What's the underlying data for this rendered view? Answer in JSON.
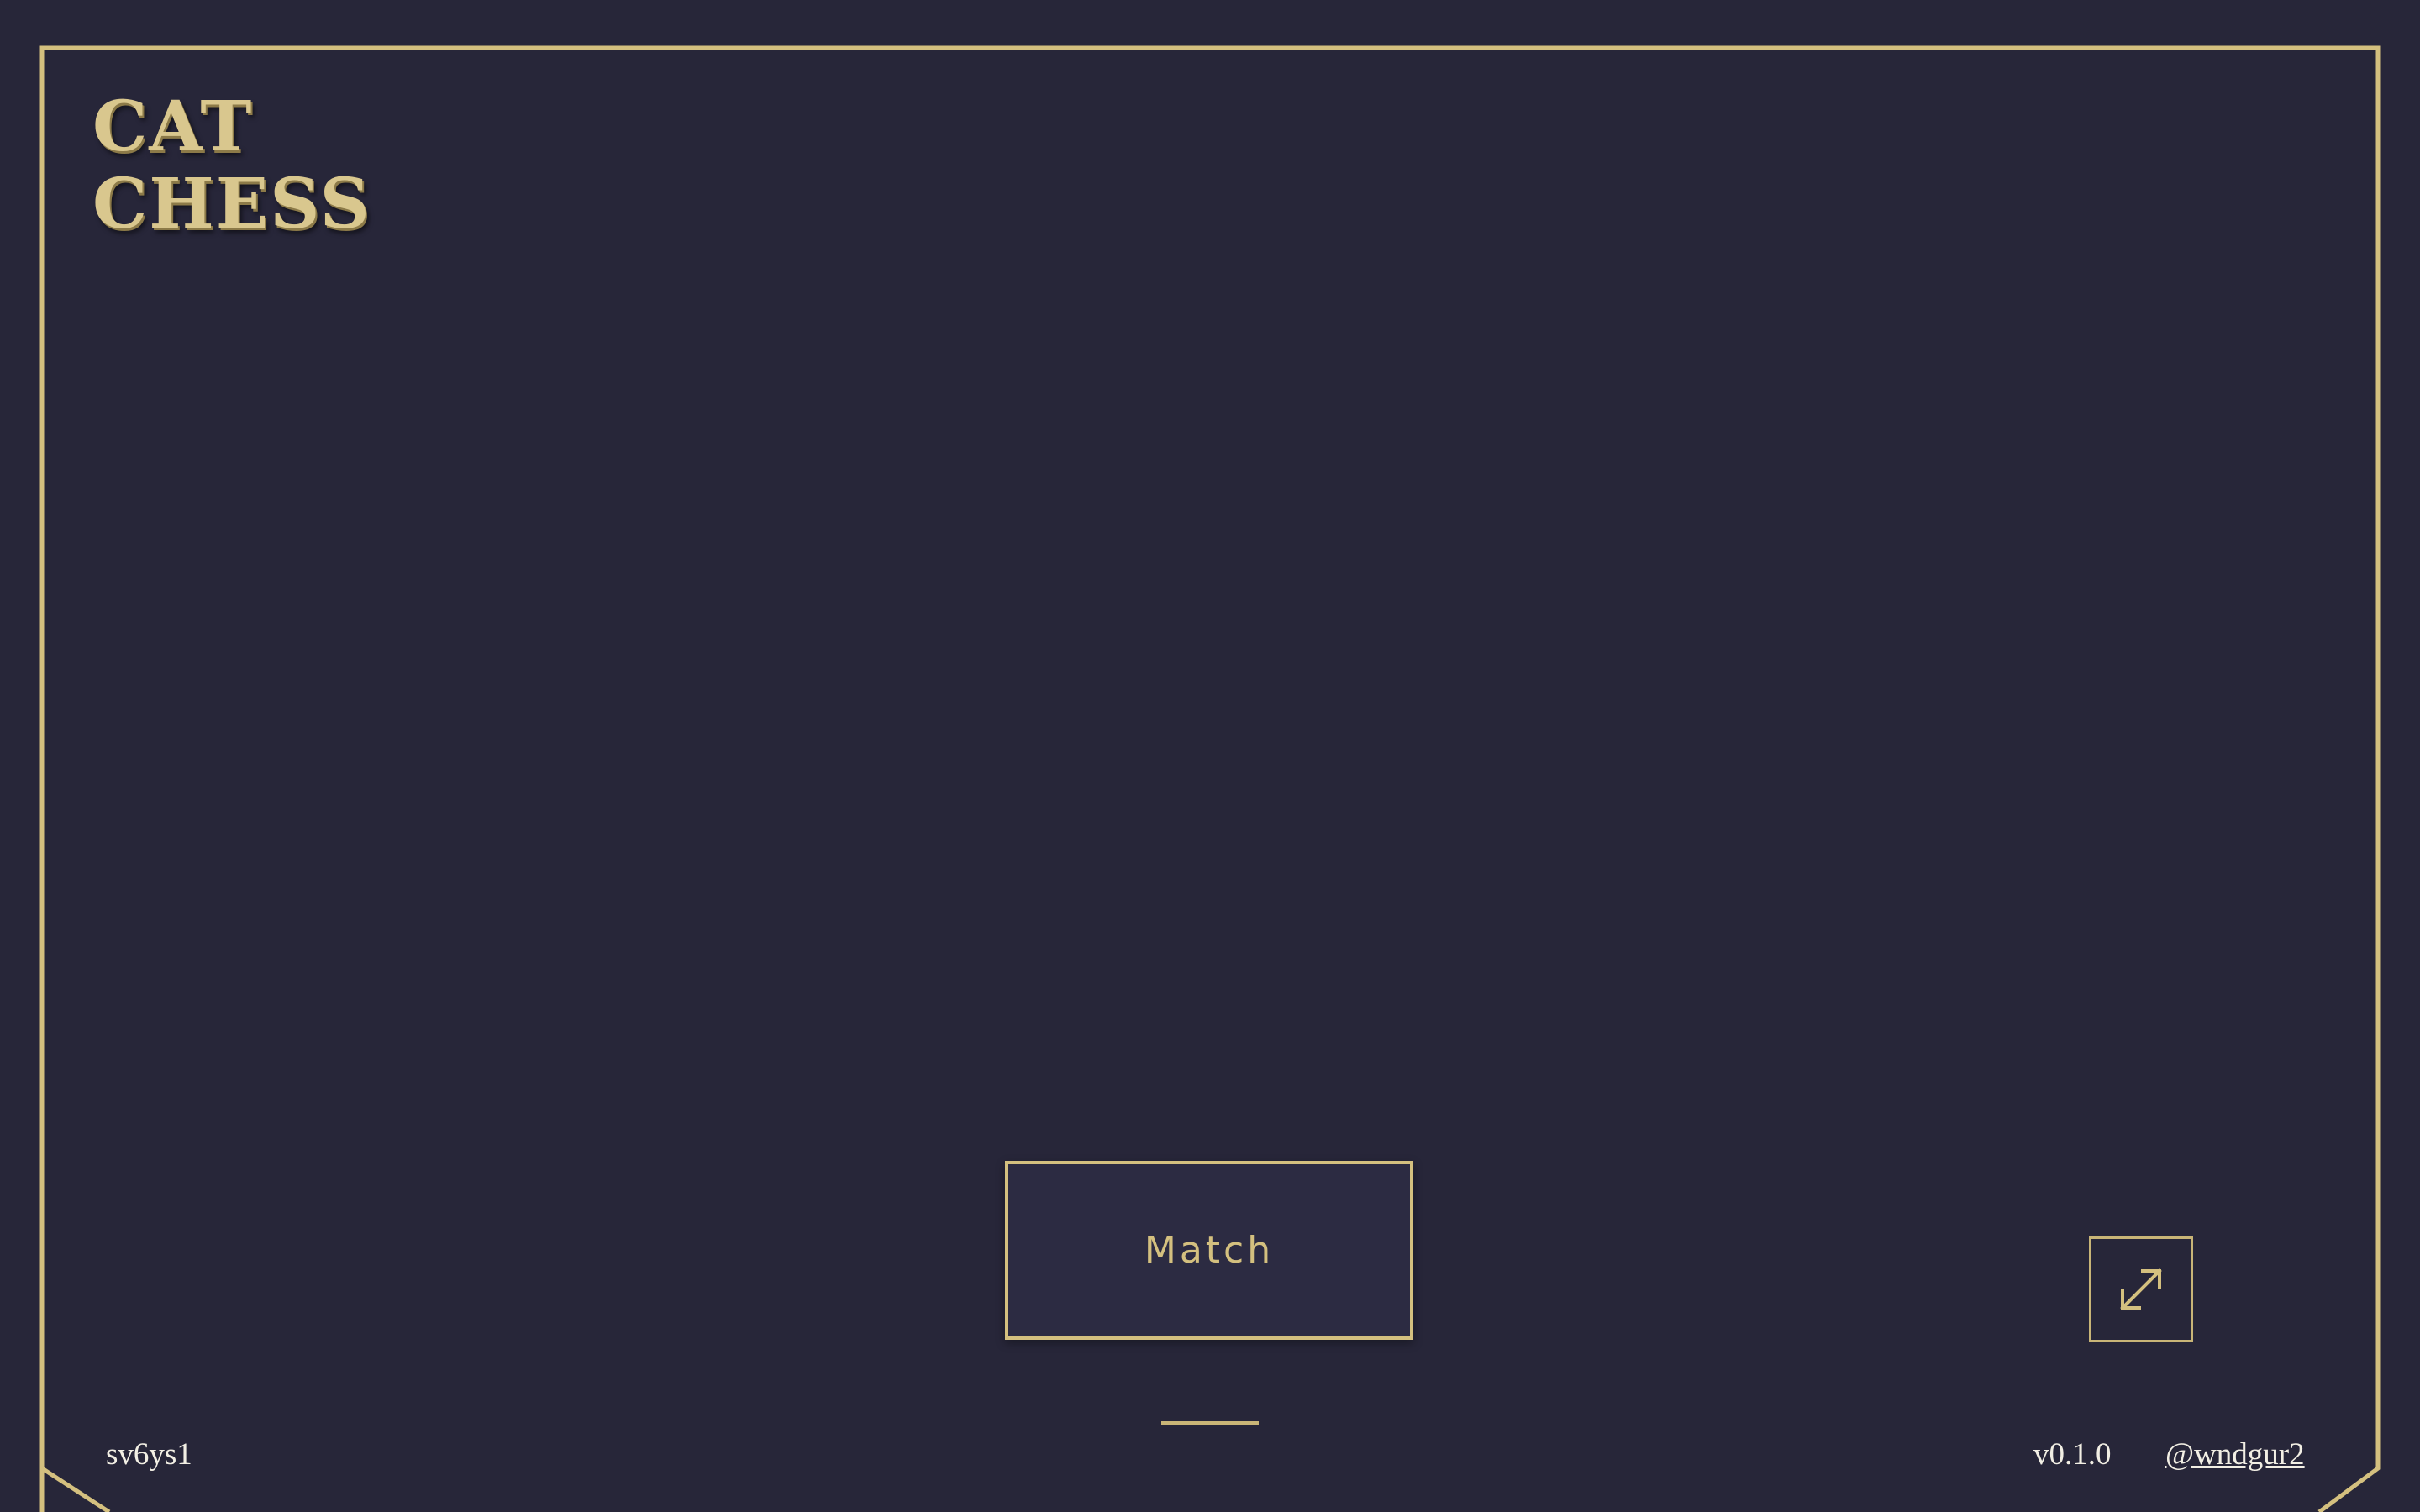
{
  "logo": {
    "line1": "CAT",
    "line2": "CHESS"
  },
  "match_button": {
    "label": "Match"
  },
  "fullscreen_button": {
    "icon": "expand-diagonal-icon"
  },
  "footer": {
    "room_code": "sv6ys1",
    "version": "v0.1.0",
    "author": "@wndgur2"
  },
  "colors": {
    "background": "#272639",
    "gold": "#d4c07f",
    "button_fill": "#2c2b42",
    "footer_text": "#f2efe4"
  }
}
